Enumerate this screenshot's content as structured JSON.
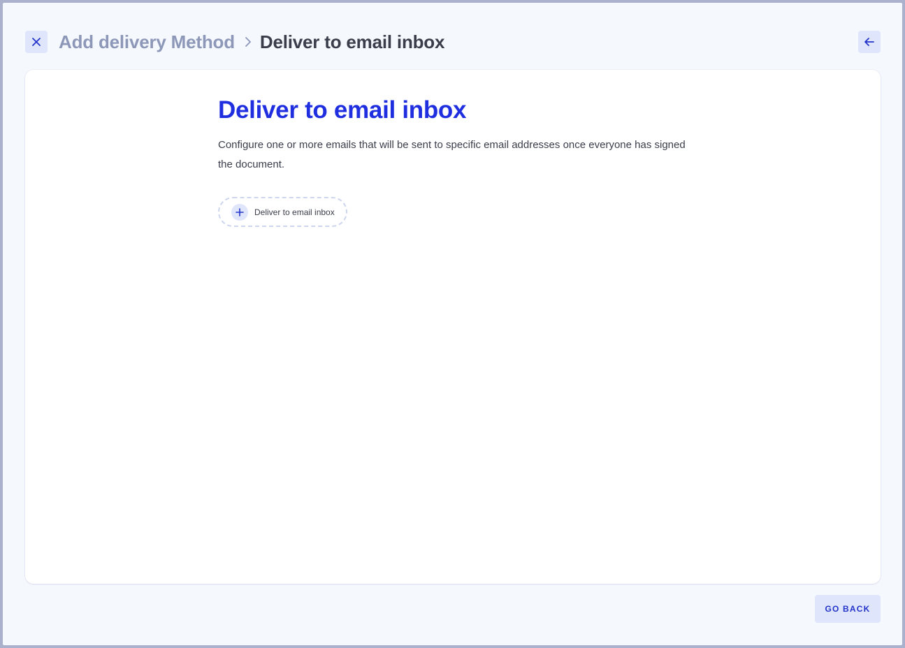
{
  "header": {
    "close_icon": "close-icon",
    "breadcrumb": {
      "parent": "Add delivery Method",
      "separator_icon": "chevron-right-icon",
      "current": "Deliver to email inbox"
    },
    "back_icon": "arrow-left-icon"
  },
  "main": {
    "title": "Deliver to email inbox",
    "description": "Configure one or more emails that will be sent to specific email addresses once everyone has signed the document.",
    "add_button": {
      "icon": "plus-icon",
      "label": "Deliver to email inbox"
    }
  },
  "footer": {
    "go_back_label": "GO BACK"
  },
  "colors": {
    "accent": "#1f2fe0",
    "button_bg": "#dfe6fb",
    "button_text": "#2333c9",
    "dialog_bg": "#f5f8fd",
    "card_bg": "#ffffff",
    "muted_text": "#8d97b8",
    "body_text": "#3a3d4a"
  }
}
